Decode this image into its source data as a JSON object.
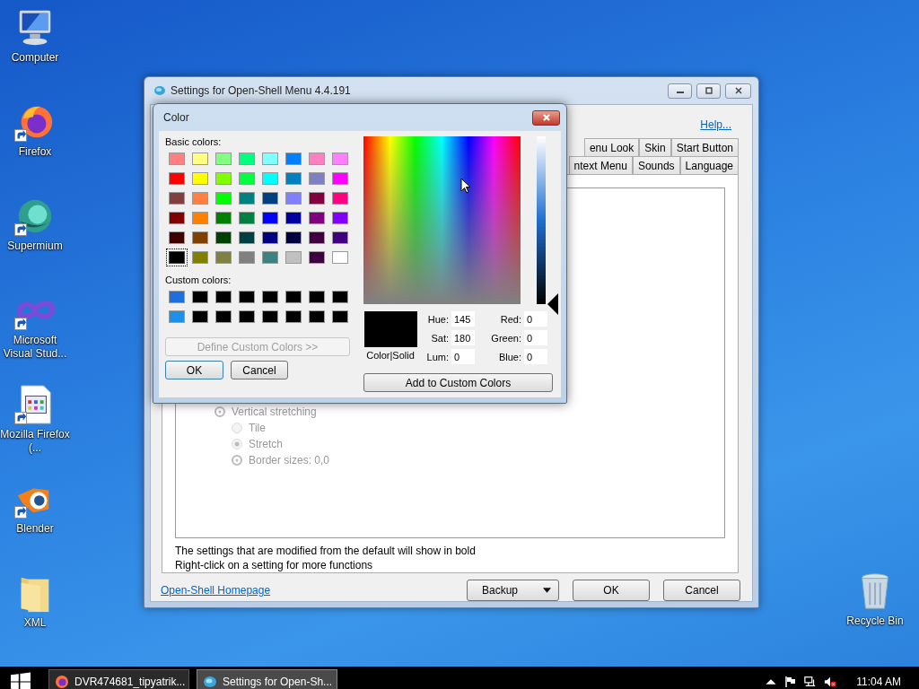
{
  "desktop_icons": [
    {
      "label": "Computer",
      "kind": "computer",
      "shortcut": false
    },
    {
      "label": "Firefox",
      "kind": "firefox",
      "shortcut": true
    },
    {
      "label": "Supermium",
      "kind": "supermium",
      "shortcut": true
    },
    {
      "label": "Microsoft Visual Stud...",
      "kind": "infinity",
      "shortcut": true
    },
    {
      "label": "Mozilla Firefox (...",
      "kind": "document",
      "shortcut": true
    },
    {
      "label": "Blender",
      "kind": "blender",
      "shortcut": true
    },
    {
      "label": "XML",
      "kind": "folder",
      "shortcut": false
    }
  ],
  "recycle_bin": {
    "label": "Recycle Bin"
  },
  "settings_window": {
    "title": "Settings for Open-Shell Menu 4.4.191",
    "help_link": "Help...",
    "tab_rows": [
      [
        {
          "label": "enu Look",
          "selected": false
        },
        {
          "label": "Skin",
          "selected": false
        },
        {
          "label": "Start Button",
          "selected": false
        }
      ],
      [
        {
          "label": "ntext Menu",
          "selected": false
        },
        {
          "label": "Sounds",
          "selected": false
        },
        {
          "label": "Language",
          "selected": false
        }
      ]
    ],
    "tree": [
      {
        "label": "Vertical stretching",
        "kind": "group",
        "disabled": true,
        "children": [
          {
            "label": "Tile",
            "kind": "radio",
            "disabled": true,
            "selected": false
          },
          {
            "label": "Stretch",
            "kind": "radio",
            "disabled": true,
            "selected": true
          },
          {
            "label": "Border sizes: 0,0",
            "kind": "setting",
            "disabled": true
          }
        ]
      }
    ],
    "notes": [
      "The settings that are modified from the default will show in bold",
      "Right-click on a setting for more functions"
    ],
    "homepage_link": "Open-Shell Homepage",
    "buttons": [
      {
        "label": "Backup",
        "kind": "dropdown"
      },
      {
        "label": "OK",
        "kind": "plain"
      },
      {
        "label": "Cancel",
        "kind": "plain"
      }
    ]
  },
  "color_dialog": {
    "title": "Color",
    "basic_colors_label": "Basic colors:",
    "basic_colors": [
      {
        "color": "#ff8080",
        "selected": false
      },
      {
        "color": "#ffff80",
        "selected": false
      },
      {
        "color": "#80ff80",
        "selected": false
      },
      {
        "color": "#00ff80",
        "selected": false
      },
      {
        "color": "#80ffff",
        "selected": false
      },
      {
        "color": "#0080ff",
        "selected": false
      },
      {
        "color": "#ff80c0",
        "selected": false
      },
      {
        "color": "#ff80ff",
        "selected": false
      },
      {
        "color": "#ff0000",
        "selected": false
      },
      {
        "color": "#ffff00",
        "selected": false
      },
      {
        "color": "#80ff00",
        "selected": false
      },
      {
        "color": "#00ff40",
        "selected": false
      },
      {
        "color": "#00ffff",
        "selected": false
      },
      {
        "color": "#0080c0",
        "selected": false
      },
      {
        "color": "#8080c0",
        "selected": false
      },
      {
        "color": "#ff00ff",
        "selected": false
      },
      {
        "color": "#804040",
        "selected": false
      },
      {
        "color": "#ff8040",
        "selected": false
      },
      {
        "color": "#00ff00",
        "selected": false
      },
      {
        "color": "#008080",
        "selected": false
      },
      {
        "color": "#004080",
        "selected": false
      },
      {
        "color": "#8080ff",
        "selected": false
      },
      {
        "color": "#800040",
        "selected": false
      },
      {
        "color": "#ff0080",
        "selected": false
      },
      {
        "color": "#800000",
        "selected": false
      },
      {
        "color": "#ff8000",
        "selected": false
      },
      {
        "color": "#008000",
        "selected": false
      },
      {
        "color": "#008040",
        "selected": false
      },
      {
        "color": "#0000ff",
        "selected": false
      },
      {
        "color": "#0000a0",
        "selected": false
      },
      {
        "color": "#800080",
        "selected": false
      },
      {
        "color": "#8000ff",
        "selected": false
      },
      {
        "color": "#400000",
        "selected": false
      },
      {
        "color": "#804000",
        "selected": false
      },
      {
        "color": "#004000",
        "selected": false
      },
      {
        "color": "#004040",
        "selected": false
      },
      {
        "color": "#000080",
        "selected": false
      },
      {
        "color": "#000040",
        "selected": false
      },
      {
        "color": "#400040",
        "selected": false
      },
      {
        "color": "#400080",
        "selected": false
      },
      {
        "color": "#000000",
        "selected": true
      },
      {
        "color": "#808000",
        "selected": false
      },
      {
        "color": "#808040",
        "selected": false
      },
      {
        "color": "#808080",
        "selected": false
      },
      {
        "color": "#408080",
        "selected": false
      },
      {
        "color": "#c0c0c0",
        "selected": false
      },
      {
        "color": "#400040",
        "selected": false
      },
      {
        "color": "#ffffff",
        "selected": false
      }
    ],
    "custom_colors_label": "Custom colors:",
    "custom_colors": [
      {
        "color": "#1c6fdc"
      },
      {
        "color": "#000000"
      },
      {
        "color": "#000000"
      },
      {
        "color": "#000000"
      },
      {
        "color": "#000000"
      },
      {
        "color": "#000000"
      },
      {
        "color": "#000000"
      },
      {
        "color": "#000000"
      },
      {
        "color": "#1e90e8"
      },
      {
        "color": "#000000"
      },
      {
        "color": "#000000"
      },
      {
        "color": "#000000"
      },
      {
        "color": "#000000"
      },
      {
        "color": "#000000"
      },
      {
        "color": "#000000"
      },
      {
        "color": "#000000"
      }
    ],
    "define_button": {
      "label": "Define Custom Colors >>",
      "disabled": true
    },
    "ok_button": "OK",
    "cancel_button": "Cancel",
    "luminance": {
      "level": 0
    },
    "preview_label": "Color|Solid",
    "fields": [
      {
        "label": "Hue:",
        "value": "145"
      },
      {
        "label": "Red:",
        "value": "0"
      },
      {
        "label": "Sat:",
        "value": "180"
      },
      {
        "label": "Green:",
        "value": "0"
      },
      {
        "label": "Lum:",
        "value": "0"
      },
      {
        "label": "Blue:",
        "value": "0"
      }
    ],
    "add_button": "Add to Custom Colors"
  },
  "taskbar": {
    "tasks": [
      {
        "label": "DVR474681_tipyatrik...",
        "kind": "firefox",
        "selected": false
      },
      {
        "label": "Settings for Open-Sh...",
        "kind": "shell",
        "selected": true
      }
    ],
    "clock": "11:04 AM"
  }
}
